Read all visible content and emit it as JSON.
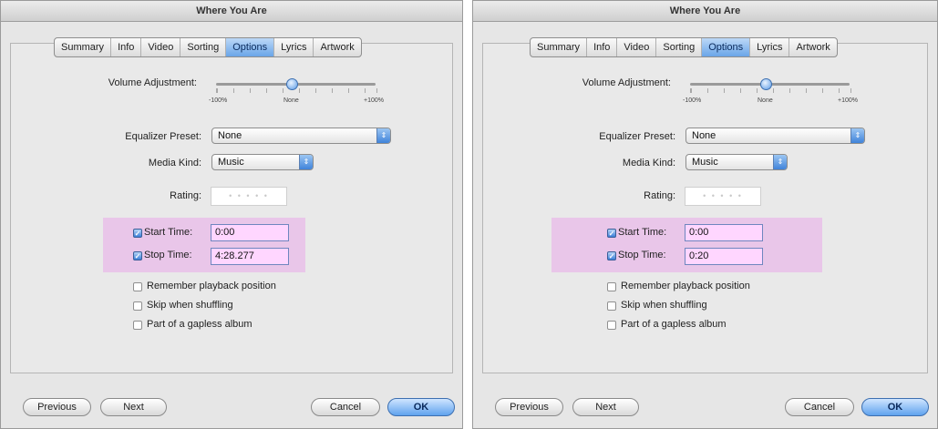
{
  "dialogs": [
    {
      "title": "Where You Are",
      "tabs": [
        "Summary",
        "Info",
        "Video",
        "Sorting",
        "Options",
        "Lyrics",
        "Artwork"
      ],
      "active_tab": "Options",
      "volume": {
        "label": "Volume Adjustment:",
        "min_label": "-100%",
        "mid_label": "None",
        "max_label": "+100%"
      },
      "equalizer": {
        "label": "Equalizer Preset:",
        "value": "None"
      },
      "media_kind": {
        "label": "Media Kind:",
        "value": "Music"
      },
      "rating": {
        "label": "Rating:",
        "placeholder": "• • • • •"
      },
      "start_time": {
        "label": "Start Time:",
        "value": "0:00",
        "checked": true
      },
      "stop_time": {
        "label": "Stop Time:",
        "value": "4:28.277",
        "checked": true
      },
      "options": [
        "Remember playback position",
        "Skip when shuffling",
        "Part of a gapless album"
      ],
      "buttons": {
        "previous": "Previous",
        "next": "Next",
        "cancel": "Cancel",
        "ok": "OK"
      }
    },
    {
      "title": "Where You Are",
      "tabs": [
        "Summary",
        "Info",
        "Video",
        "Sorting",
        "Options",
        "Lyrics",
        "Artwork"
      ],
      "active_tab": "Options",
      "volume": {
        "label": "Volume Adjustment:",
        "min_label": "-100%",
        "mid_label": "None",
        "max_label": "+100%"
      },
      "equalizer": {
        "label": "Equalizer Preset:",
        "value": "None"
      },
      "media_kind": {
        "label": "Media Kind:",
        "value": "Music"
      },
      "rating": {
        "label": "Rating:",
        "placeholder": "• • • • •"
      },
      "start_time": {
        "label": "Start Time:",
        "value": "0:00",
        "checked": true
      },
      "stop_time": {
        "label": "Stop Time:",
        "value": "0:20",
        "checked": true
      },
      "options": [
        "Remember playback position",
        "Skip when shuffling",
        "Part of a gapless album"
      ],
      "buttons": {
        "previous": "Previous",
        "next": "Next",
        "cancel": "Cancel",
        "ok": "OK"
      }
    }
  ]
}
